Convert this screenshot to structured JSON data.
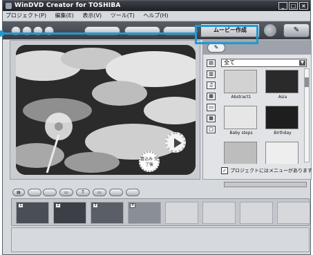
{
  "window": {
    "title": "WinDVD Creator for TOSHIBA",
    "controls": [
      "_",
      "□",
      "×"
    ]
  },
  "menu": [
    "プロジェクト(P)",
    "編集(E)",
    "表示(V)",
    "ツール(T)",
    "ヘルプ(H)"
  ],
  "toolbar": {
    "active_tab": "ムービー作成"
  },
  "library": {
    "category": "全て",
    "items": [
      {
        "label": "Abstract1"
      },
      {
        "label": "Asia"
      },
      {
        "label": "Baby steps"
      },
      {
        "label": "Birthday"
      },
      {
        "label": ""
      },
      {
        "label": ""
      }
    ],
    "menu_checkbox_label": "プロジェクトにはメニューがあります",
    "menu_checkbox_checked": true
  },
  "preview": {
    "badge_text": "書込み 完了後"
  },
  "storyboard": {
    "slots": [
      "1",
      "2",
      "3",
      "4",
      "",
      "",
      "",
      ""
    ]
  },
  "colors": {
    "highlight": "#1f9ad6"
  }
}
